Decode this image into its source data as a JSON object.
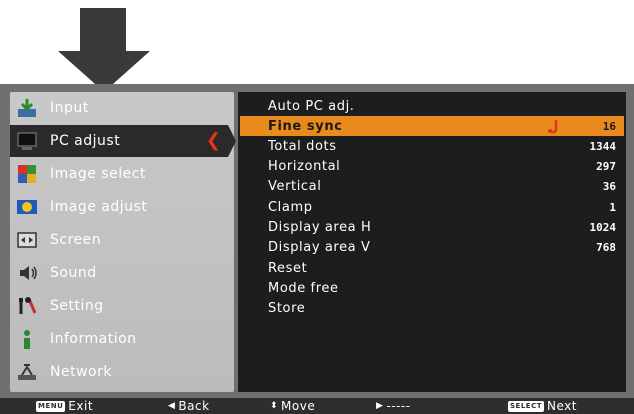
{
  "left_menu": {
    "items": [
      {
        "label": "Input",
        "icon": "input-icon"
      },
      {
        "label": "PC adjust",
        "icon": "pc-adjust-icon",
        "active": true
      },
      {
        "label": "Image select",
        "icon": "image-select-icon"
      },
      {
        "label": "Image adjust",
        "icon": "image-adjust-icon"
      },
      {
        "label": "Screen",
        "icon": "screen-icon"
      },
      {
        "label": "Sound",
        "icon": "sound-icon"
      },
      {
        "label": "Setting",
        "icon": "setting-icon"
      },
      {
        "label": "Information",
        "icon": "information-icon"
      },
      {
        "label": "Network",
        "icon": "network-icon"
      }
    ]
  },
  "right_menu": {
    "items": [
      {
        "label": "Auto PC adj.",
        "value": ""
      },
      {
        "label": "Fine sync",
        "value": "16",
        "selected": true
      },
      {
        "label": "Total dots",
        "value": "1344"
      },
      {
        "label": "Horizontal",
        "value": "297"
      },
      {
        "label": "Vertical",
        "value": "36"
      },
      {
        "label": "Clamp",
        "value": "1"
      },
      {
        "label": "Display area H",
        "value": "1024"
      },
      {
        "label": "Display area V",
        "value": "768"
      },
      {
        "label": "Reset",
        "value": ""
      },
      {
        "label": "Mode free",
        "value": ""
      },
      {
        "label": "Store",
        "value": ""
      }
    ]
  },
  "bottom_bar": {
    "menu_key": "MENU",
    "exit": "Exit",
    "back": "Back",
    "move": "Move",
    "dash": "-----",
    "select_key": "SELECT",
    "next": "Next"
  },
  "colors": {
    "highlight": "#e98a1c",
    "active_chevron": "#e8341a",
    "panel_bg": "#1d1d1d",
    "left_bg": "#c8c8c8"
  }
}
